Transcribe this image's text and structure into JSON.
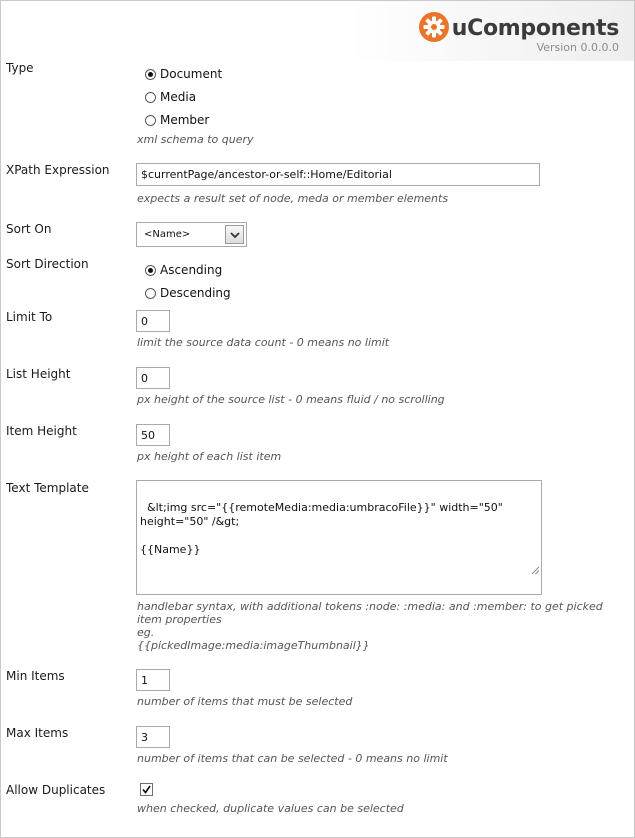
{
  "header": {
    "logo_icon": "gear-icon",
    "brand_color": "#e8752a",
    "title": "uComponents",
    "version": "Version 0.0.0.0"
  },
  "fields": {
    "type": {
      "label": "Type",
      "options": [
        "Document",
        "Media",
        "Member"
      ],
      "selected": "Document",
      "hint": "xml schema to query"
    },
    "xpath": {
      "label": "XPath Expression",
      "value": "$currentPage/ancestor-or-self::Home/Editorial",
      "hint": "expects a result set of node, meda or member elements"
    },
    "sort_on": {
      "label": "Sort On",
      "value": "<Name>"
    },
    "sort_direction": {
      "label": "Sort Direction",
      "options": [
        "Ascending",
        "Descending"
      ],
      "selected": "Ascending"
    },
    "limit_to": {
      "label": "Limit To",
      "value": "0",
      "hint": "limit the source data count - 0 means no limit"
    },
    "list_height": {
      "label": "List Height",
      "value": "0",
      "hint": "px height of the source list - 0 means fluid / no scrolling"
    },
    "item_height": {
      "label": "Item Height",
      "value": "50",
      "hint": "px height of each list item"
    },
    "text_template": {
      "label": "Text Template",
      "value": "&lt;img src=\"{{remoteMedia:media:umbracoFile}}\" width=\"50\" height=\"50\" /&gt;\n\n{{Name}}",
      "hint_line1": "handlebar syntax, with additional tokens :node: :media: and :member: to get picked",
      "hint_line2": "item properties",
      "hint_line3": "eg.",
      "hint_line4": "{{pickedImage:media:imageThumbnail}}"
    },
    "min_items": {
      "label": "Min Items",
      "value": "1",
      "hint": "number of items that must be selected"
    },
    "max_items": {
      "label": "Max Items",
      "value": "3",
      "hint": "number of items that can be selected - 0 means no limit"
    },
    "allow_duplicates": {
      "label": "Allow Duplicates",
      "checked": true,
      "hint": "when checked, duplicate values can be selected"
    }
  }
}
